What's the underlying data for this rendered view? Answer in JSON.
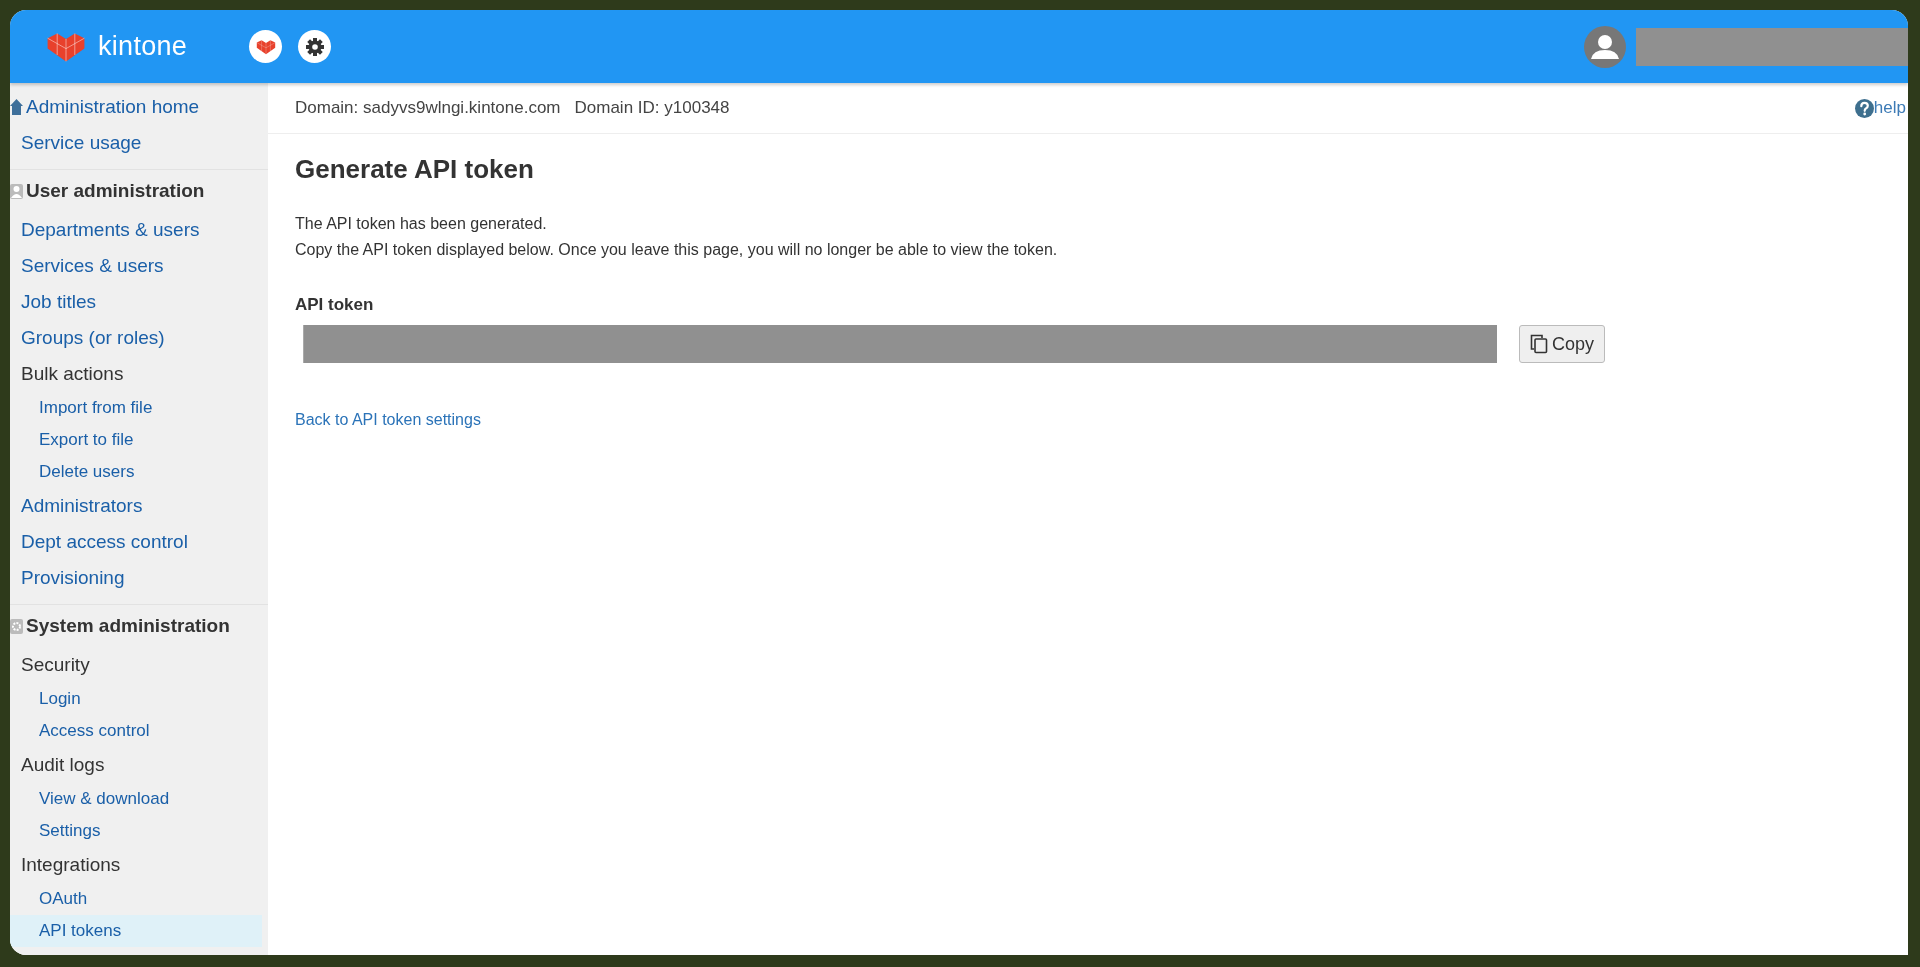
{
  "header": {
    "logo_text": "kintone"
  },
  "sidebar": {
    "items": [
      {
        "kind": "home",
        "label": "Administration home",
        "selected": false
      },
      {
        "kind": "link",
        "label": "Service usage",
        "selected": false
      },
      {
        "kind": "heading",
        "label": "User administration",
        "selected": false
      },
      {
        "kind": "link",
        "label": "Departments & users",
        "selected": false
      },
      {
        "kind": "link",
        "label": "Services & users",
        "selected": false
      },
      {
        "kind": "link",
        "label": "Job titles",
        "selected": false
      },
      {
        "kind": "link",
        "label": "Groups (or roles)",
        "selected": false
      },
      {
        "kind": "group",
        "label": "Bulk actions",
        "selected": false
      },
      {
        "kind": "sublink",
        "label": "Import from file",
        "selected": false
      },
      {
        "kind": "sublink",
        "label": "Export to file",
        "selected": false
      },
      {
        "kind": "sublink",
        "label": "Delete users",
        "selected": false
      },
      {
        "kind": "link",
        "label": "Administrators",
        "selected": false
      },
      {
        "kind": "link",
        "label": "Dept access control",
        "selected": false
      },
      {
        "kind": "link",
        "label": "Provisioning",
        "selected": false
      },
      {
        "kind": "heading",
        "label": "System administration",
        "selected": false
      },
      {
        "kind": "group",
        "label": "Security",
        "selected": false
      },
      {
        "kind": "sublink",
        "label": "Login",
        "selected": false
      },
      {
        "kind": "sublink",
        "label": "Access control",
        "selected": false
      },
      {
        "kind": "group",
        "label": "Audit logs",
        "selected": false
      },
      {
        "kind": "sublink",
        "label": "View & download",
        "selected": false
      },
      {
        "kind": "sublink",
        "label": "Settings",
        "selected": false
      },
      {
        "kind": "group",
        "label": "Integrations",
        "selected": false
      },
      {
        "kind": "sublink",
        "label": "OAuth",
        "selected": false
      },
      {
        "kind": "sublink",
        "label": "API tokens",
        "selected": true
      }
    ]
  },
  "domain_bar": {
    "domain": "Domain: sadyvs9wlngi.kintone.com",
    "domain_id": "Domain ID: y100348",
    "help": "help"
  },
  "page": {
    "title": "Generate API token",
    "messages": [
      "The API token has been generated.",
      "Copy the API token displayed below. Once you leave this page, you will no longer be able to view the token."
    ],
    "token_label": "API token",
    "copy_button": "Copy",
    "back_link": "Back to API token settings"
  }
}
